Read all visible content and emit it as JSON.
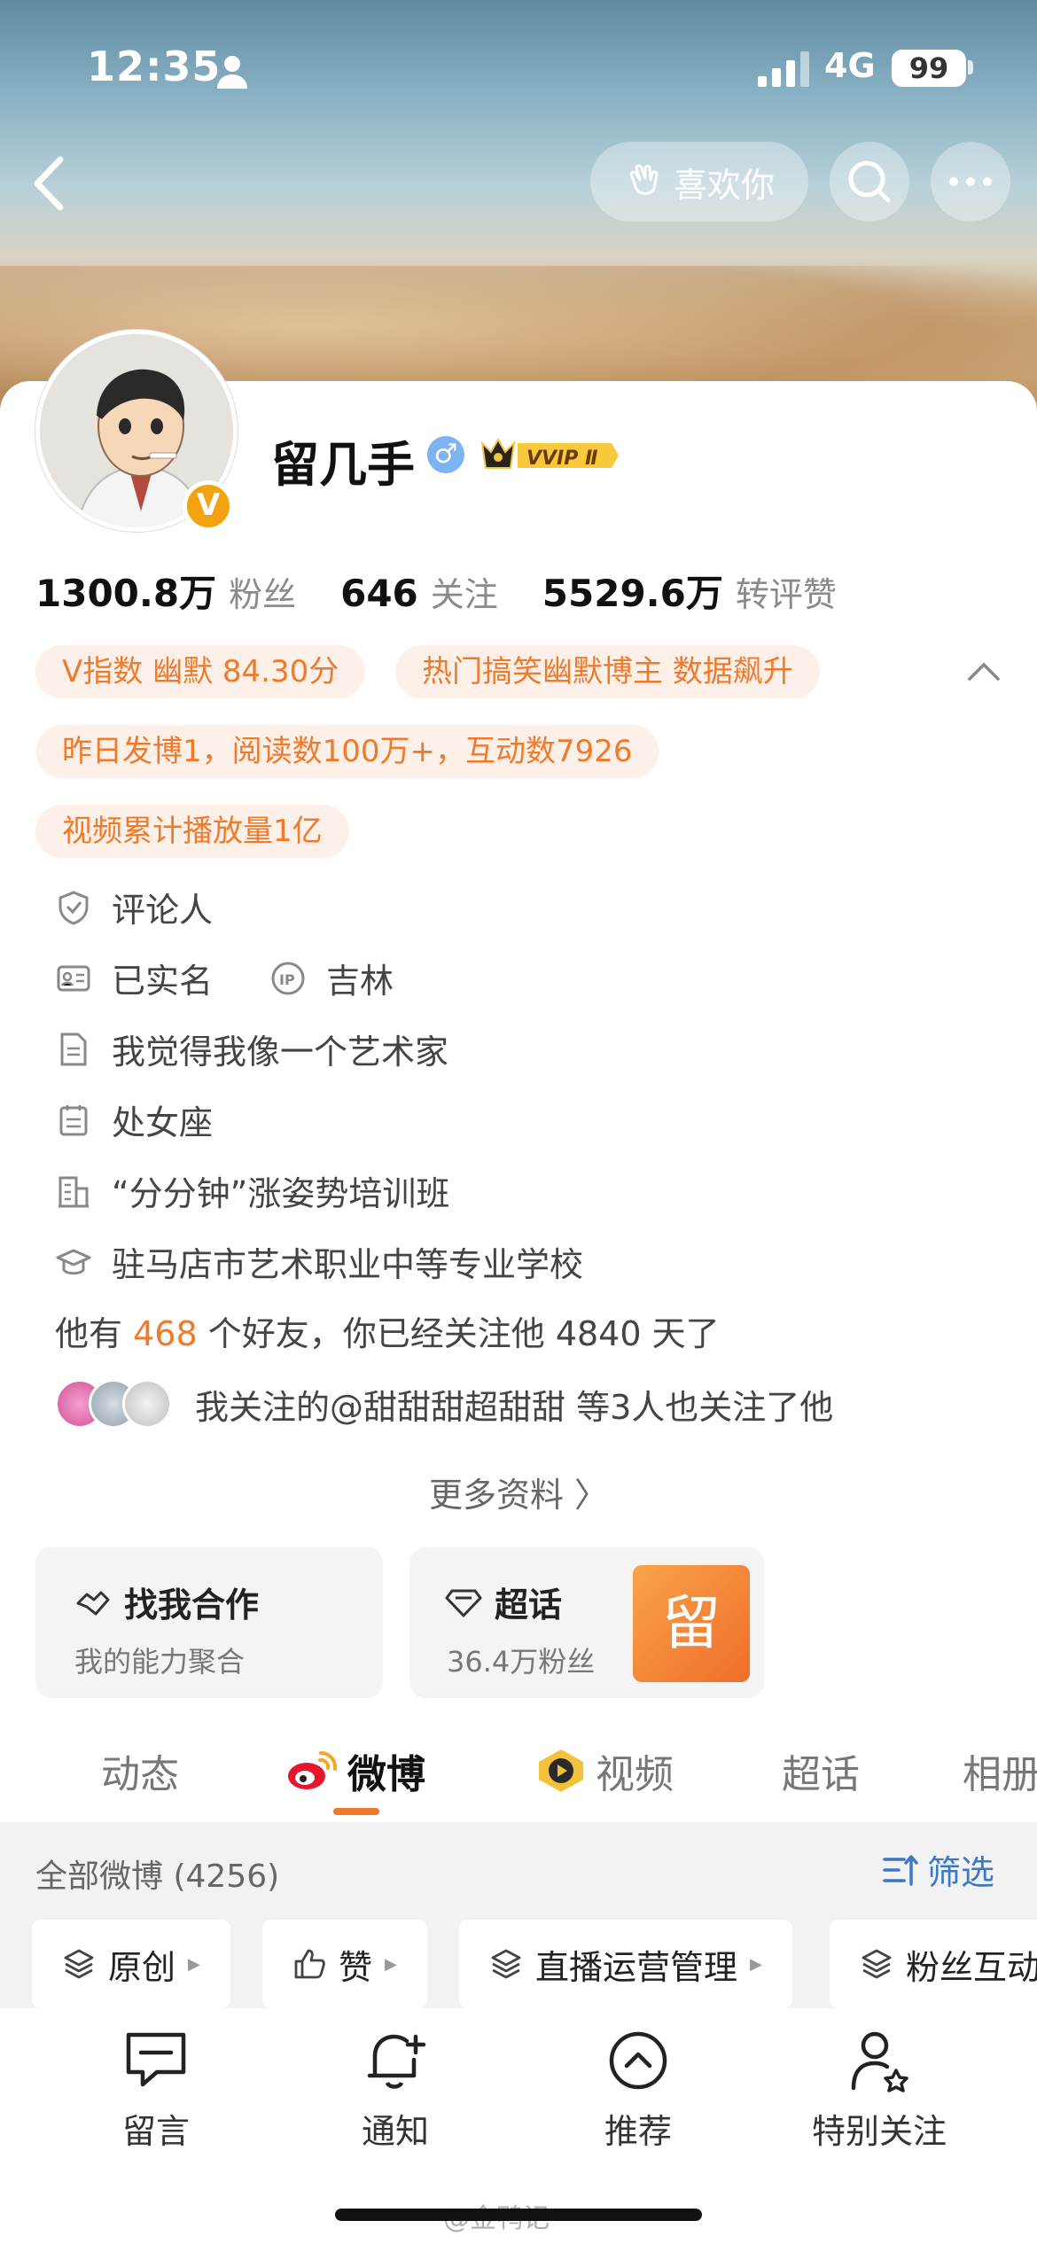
{
  "status_bar": {
    "time": "12:35",
    "network": "4G",
    "battery": "99"
  },
  "header": {
    "like_button_label": "喜欢你"
  },
  "profile": {
    "name": "留几手",
    "gender_symbol": "♂",
    "vip_label": "VVIP Ⅱ",
    "verified_badge": "V",
    "stats": [
      {
        "value": "1300.8万",
        "label": "粉丝"
      },
      {
        "value": "646",
        "label": "关注"
      },
      {
        "value": "5529.6万",
        "label": "转评赞"
      }
    ],
    "tags": [
      "V指数 幽默 84.30分",
      "热门搞笑幽默博主 数据飙升",
      "昨日发博1，阅读数100万+，互动数7926",
      "视频累计播放量1亿"
    ],
    "info": {
      "commenter": "评论人",
      "real_name": "已实名",
      "ip": "吉林",
      "bio": "我觉得我像一个艺术家",
      "zodiac": "处女座",
      "company": "“分分钟”涨姿势培训班",
      "school": "驻马店市艺术职业中等专业学校"
    },
    "friends": {
      "prefix": "他有",
      "count": "468",
      "suffix": "个好友，你已经关注他 4840 天了"
    },
    "mutual_follow": "我关注的@甜甜甜超甜甜 等3人也关注了他",
    "more_info": "更多资料 〉"
  },
  "cards": {
    "coop": {
      "title": "找我合作",
      "subtitle": "我的能力聚合"
    },
    "super_topic": {
      "title": "超话",
      "subtitle": "36.4万粉丝",
      "thumb_char": "留"
    }
  },
  "tabs": [
    {
      "label": "动态",
      "active": false
    },
    {
      "label": "微博",
      "active": true
    },
    {
      "label": "视频",
      "active": false
    },
    {
      "label": "超话",
      "active": false
    },
    {
      "label": "相册",
      "active": false
    }
  ],
  "feed": {
    "all_weibo": "全部微博 (4256)",
    "filter_label": "筛选",
    "chips": [
      "原创",
      "赞",
      "直播运营管理",
      "粉丝互动"
    ]
  },
  "bottom_nav": [
    {
      "label": "留言",
      "icon": "message-icon"
    },
    {
      "label": "通知",
      "icon": "bell-plus-icon"
    },
    {
      "label": "推荐",
      "icon": "chevron-up-circle-icon"
    },
    {
      "label": "特别关注",
      "icon": "person-star-icon"
    }
  ],
  "watermark": "@金鸭记",
  "colors": {
    "accent": "#f07a2c",
    "tag_bg": "#fdf0e8",
    "link_blue": "#3c78c8",
    "verified_gold": "#f3a30f"
  }
}
